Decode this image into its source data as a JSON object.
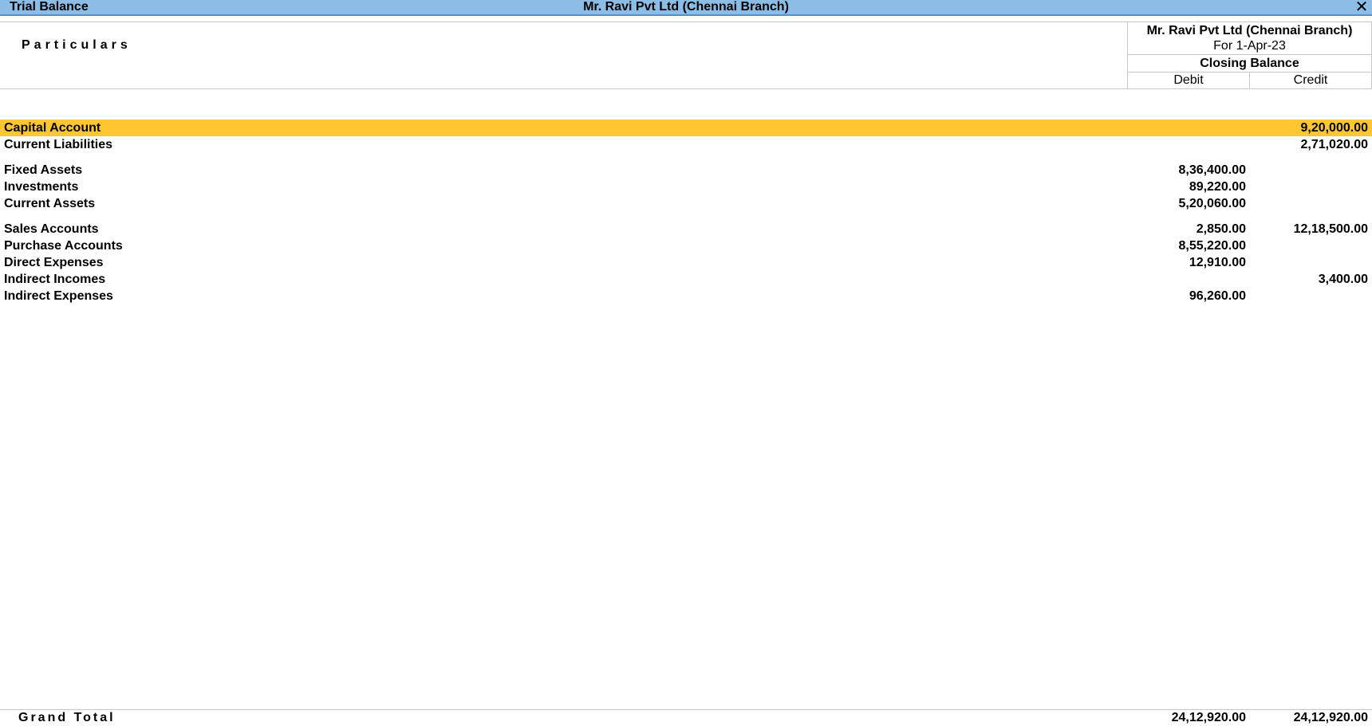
{
  "window": {
    "title": "Trial Balance",
    "company_title": "Mr. Ravi Pvt Ltd (Chennai Branch)",
    "close_icon": "close-icon"
  },
  "header": {
    "particulars_label": "Particulars",
    "company": "Mr. Ravi Pvt Ltd (Chennai Branch)",
    "period": "For 1-Apr-23",
    "closing_balance_label": "Closing Balance",
    "debit_label": "Debit",
    "credit_label": "Credit"
  },
  "colors": {
    "titlebar": "#8bbde6",
    "selected_row": "#fec631"
  },
  "rows": [
    {
      "name": "Capital Account",
      "debit": "",
      "credit": "9,20,000.00"
    },
    {
      "name": "Current Liabilities",
      "debit": "",
      "credit": "2,71,020.00"
    },
    {
      "name": "Fixed Assets",
      "debit": "8,36,400.00",
      "credit": ""
    },
    {
      "name": "Investments",
      "debit": "89,220.00",
      "credit": ""
    },
    {
      "name": "Current Assets",
      "debit": "5,20,060.00",
      "credit": ""
    },
    {
      "name": "Sales Accounts",
      "debit": "2,850.00",
      "credit": "12,18,500.00"
    },
    {
      "name": "Purchase Accounts",
      "debit": "8,55,220.00",
      "credit": ""
    },
    {
      "name": "Direct Expenses",
      "debit": "12,910.00",
      "credit": ""
    },
    {
      "name": "Indirect Incomes",
      "debit": "",
      "credit": "3,400.00"
    },
    {
      "name": "Indirect Expenses",
      "debit": "96,260.00",
      "credit": ""
    }
  ],
  "total": {
    "label": "Grand Total",
    "debit": "24,12,920.00",
    "credit": "24,12,920.00"
  }
}
